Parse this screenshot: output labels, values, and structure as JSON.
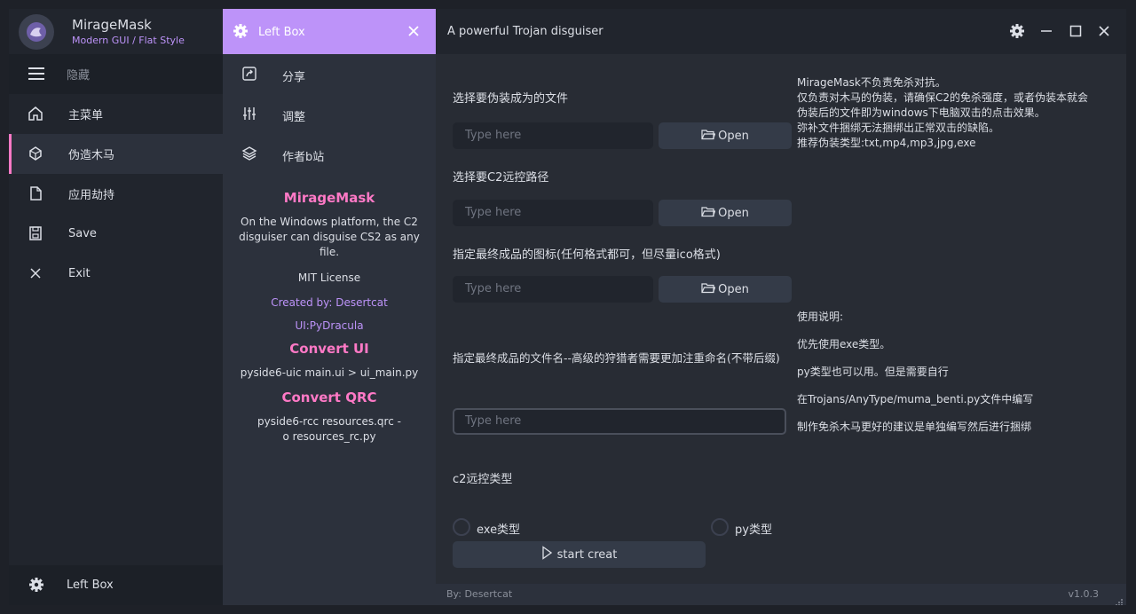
{
  "app": {
    "title": "MirageMask",
    "subtitle": "Modern GUI / Flat Style",
    "description": "A powerful Trojan disguiser"
  },
  "sidebar": {
    "toggle_label": "隐藏",
    "items": [
      {
        "label": "主菜单",
        "icon": "home-icon"
      },
      {
        "label": "伪造木马",
        "icon": "trojan-icon"
      },
      {
        "label": "应用劫持",
        "icon": "file-icon"
      },
      {
        "label": "Save",
        "icon": "save-icon"
      },
      {
        "label": "Exit",
        "icon": "close-icon"
      }
    ],
    "bottom_label": "Left Box"
  },
  "left_box": {
    "header_label": "Left Box",
    "items": [
      {
        "label": "分享",
        "icon": "share-icon"
      },
      {
        "label": "调整",
        "icon": "sliders-icon"
      },
      {
        "label": "作者b站",
        "icon": "layers-icon"
      }
    ],
    "info": {
      "heading": "MirageMask",
      "description": "On the Windows platform, the C2 disguiser can disguise CS2 as any file.",
      "license": "MIT License",
      "created_by": "Created by: Desertcat",
      "ui_credit": "UI:PyDracula",
      "convert_ui_heading": "Convert UI",
      "convert_ui_cmd": "pyside6-uic main.ui > ui_main.py",
      "convert_qrc_heading": "Convert QRC",
      "convert_qrc_cmd": "pyside6-rcc resources.qrc -o resources_rc.py"
    }
  },
  "main": {
    "field1_label": "选择要伪装成为的文件",
    "field1_placeholder": "Type here",
    "field2_label": "选择要C2远控路径",
    "field2_placeholder": "Type here",
    "field3_label": "指定最终成品的图标(任何格式都可，但尽量ico格式)",
    "field3_placeholder": "Type here",
    "field4_label": "指定最终成品的文件名--高级的狩猎者需要更加注重命名(不带后缀)",
    "field4_placeholder": "Type here",
    "open_label": "Open",
    "c2_type_label": "c2远控类型",
    "radio_exe": "exe类型",
    "radio_py": "py类型",
    "start_label": "start creat",
    "notes_top": [
      "MirageMask不负责免杀对抗。",
      "仅负责对木马的伪装，请确保C2的免杀强度，或者伪装本就会",
      "伪装后的文件即为windows下电脑双击的点击效果。",
      "弥补文件捆绑无法捆绑出正常双击的缺陷。",
      "推荐伪装类型:txt,mp4,mp3,jpg,exe"
    ],
    "notes_usage": [
      "使用说明:",
      "优先使用exe类型。",
      "py类型也可以用。但是需要自行",
      "在Trojans/AnyType/muma_benti.py文件中编写",
      "制作免杀木马更好的建议是单独编写然后进行捆绑"
    ]
  },
  "footer": {
    "credit": "By: Desertcat",
    "version": "v1.0.3"
  }
}
